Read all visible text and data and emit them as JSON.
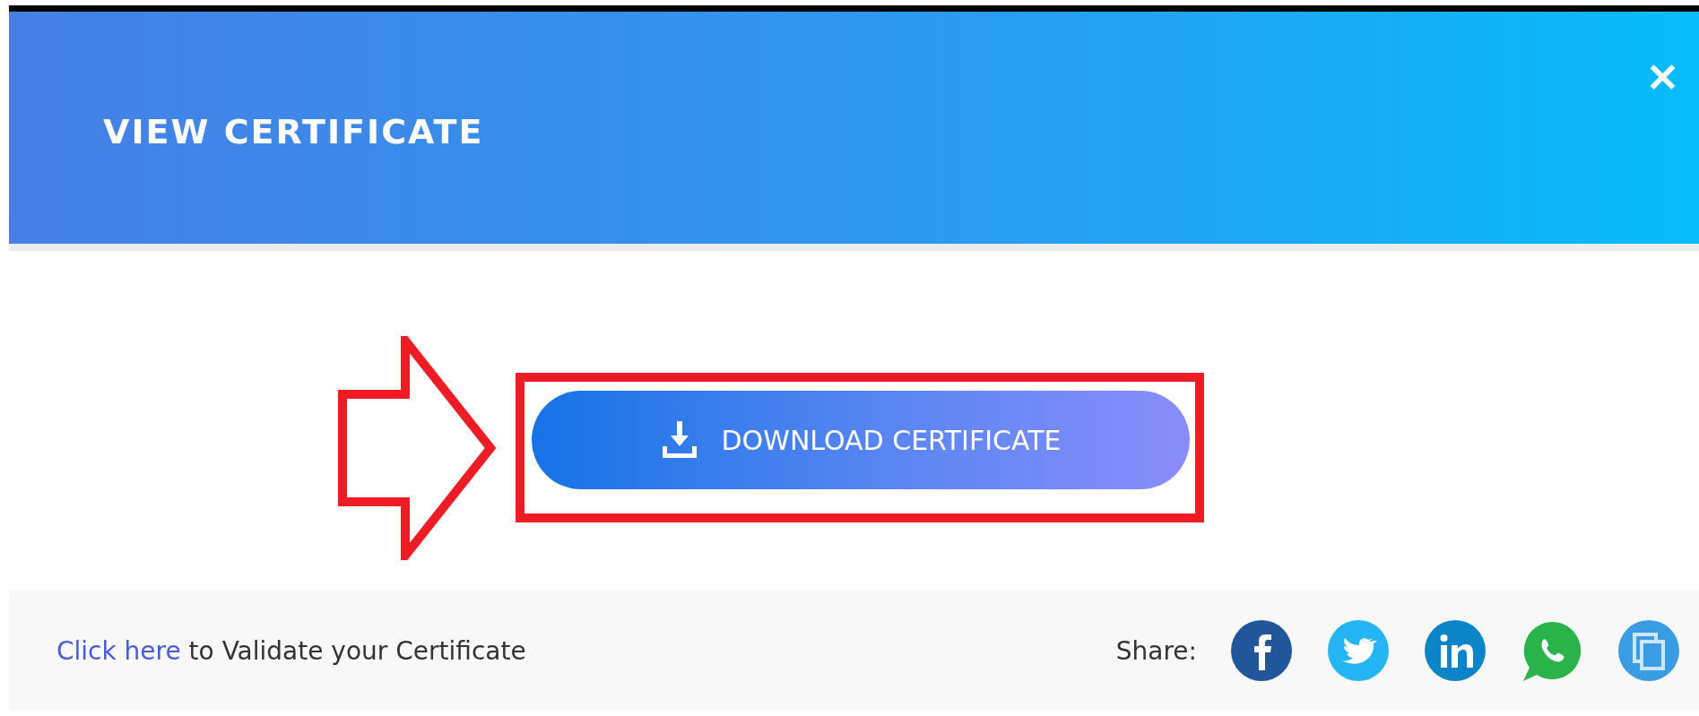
{
  "dialog": {
    "title": "VIEW CERTIFICATE",
    "close": "✕"
  },
  "download_button": {
    "label": "DOWNLOAD CERTIFICATE"
  },
  "footer": {
    "link": "Click here",
    "text": " to Validate your Certificate",
    "share_label": "Share:",
    "share_buttons": [
      {
        "kind": "facebook",
        "color": "#22569a"
      },
      {
        "kind": "twitter",
        "color": "#24b5f5"
      },
      {
        "kind": "linkedin",
        "color": "#0b85c7"
      },
      {
        "kind": "whatsapp",
        "color": "#2ab34a"
      },
      {
        "kind": "copy",
        "color": "#3a9de4"
      }
    ]
  }
}
